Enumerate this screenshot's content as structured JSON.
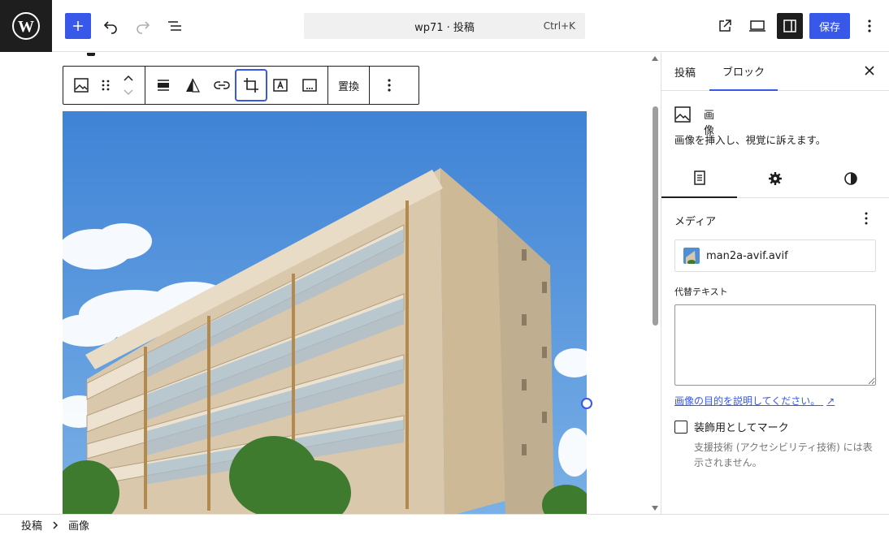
{
  "header": {
    "command_title": "wp71 · 投稿",
    "command_shortcut": "Ctrl+K",
    "save_label": "保存",
    "icons": [
      "wordpress-logo",
      "plus-icon",
      "undo-icon",
      "redo-icon",
      "list-view-icon",
      "external-link-icon",
      "desktop-preview-icon",
      "sidebar-toggle-icon",
      "more-vertical-icon"
    ]
  },
  "block_toolbar": {
    "replace_label": "置換",
    "icons": [
      "image-icon",
      "drag-handle-icon",
      "move-up-down-icon",
      "align-icon",
      "duotone-icon",
      "link-icon",
      "crop-icon",
      "text-overlay-icon",
      "caption-icon",
      "more-vertical-icon"
    ]
  },
  "sidebar": {
    "tabs": [
      "投稿",
      "ブロック"
    ],
    "active_tab": "ブロック",
    "block_name": "画像",
    "block_description": "画像を挿入し、視覚に訴えます。",
    "subtabs": [
      "settings-list-icon",
      "gear-icon",
      "contrast-icon"
    ],
    "media_title": "メディア",
    "media_filename": "man2a-avif.avif",
    "alt_label": "代替テキスト",
    "alt_value": "",
    "help_link": "画像の目的を説明してください。",
    "help_link_arrow": "↗",
    "decorative_label": "装飾用としてマーク",
    "decorative_help": "支援技術 (アクセシビリティ技術) には表示されません。"
  },
  "breadcrumb": [
    "投稿",
    "画像"
  ],
  "colors": {
    "accent": "#3858e9",
    "dark": "#1e1e1e",
    "sky": "#4f8fd6",
    "building": "#d8c7ad"
  }
}
